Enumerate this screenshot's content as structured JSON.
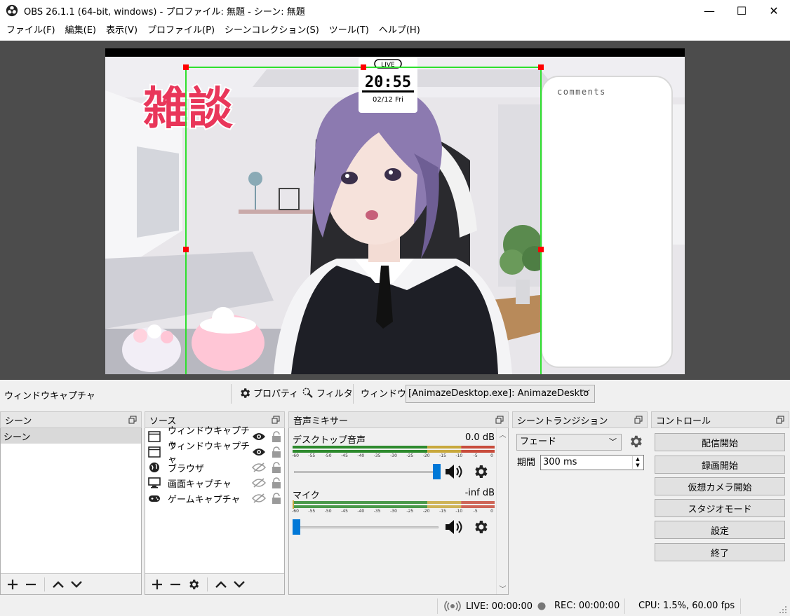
{
  "window": {
    "title": "OBS 26.1.1 (64-bit, windows) - プロファイル: 無題 - シーン: 無題",
    "minimize": "—",
    "maximize": "☐",
    "close": "✕"
  },
  "menu": [
    "ファイル(F)",
    "編集(E)",
    "表示(V)",
    "プロファイル(P)",
    "シーンコレクション(S)",
    "ツール(T)",
    "ヘルプ(H)"
  ],
  "preview": {
    "clock_badge": "LIVE",
    "clock_time": "20:55",
    "clock_date": "02/12 Fri",
    "title_sticker": "雑談",
    "comments_label": "comments"
  },
  "source_toolbar": {
    "selected_source": "ウィンドウキャプチャ",
    "properties": "プロパティ",
    "filters": "フィルタ",
    "window_label": "ウィンドウ",
    "window_value": "[AnimazeDesktop.exe]: AnimazeDeskto"
  },
  "scenes": {
    "title": "シーン",
    "items": [
      "シーン"
    ]
  },
  "sources": {
    "title": "ソース",
    "items": [
      {
        "label": "ウィンドウキャプチャ",
        "icon": "window-icon",
        "visible": true
      },
      {
        "label": "ウィンドウキャプチャ",
        "icon": "window-icon",
        "visible": true
      },
      {
        "label": "ブラウザ",
        "icon": "globe-icon",
        "visible": false
      },
      {
        "label": "画面キャプチャ",
        "icon": "monitor-icon",
        "visible": false
      },
      {
        "label": "ゲームキャプチャ",
        "icon": "gamepad-icon",
        "visible": false
      }
    ]
  },
  "mixer": {
    "title": "音声ミキサー",
    "ticks": [
      "-60",
      "-55",
      "-50",
      "-45",
      "-40",
      "-35",
      "-30",
      "-25",
      "-20",
      "-15",
      "-10",
      "-5",
      "0"
    ],
    "channels": [
      {
        "name": "デスクトップ音声",
        "db": "0.0 dB",
        "level": 1.0
      },
      {
        "name": "マイク",
        "db": "-inf dB",
        "level": 0.0
      }
    ]
  },
  "transitions": {
    "title": "シーントランジション",
    "selected": "フェード",
    "duration_label": "期間",
    "duration_value": "300 ms"
  },
  "controls": {
    "title": "コントロール",
    "buttons": [
      "配信開始",
      "録画開始",
      "仮想カメラ開始",
      "スタジオモード",
      "設定",
      "終了"
    ]
  },
  "status": {
    "live": "LIVE: 00:00:00",
    "rec": "REC: 00:00:00",
    "cpu": "CPU: 1.5%, 60.00 fps"
  },
  "colors": {
    "accent": "#0078d7",
    "meter_green": "#2d8a2d",
    "meter_yellow": "#c8a83c",
    "meter_red": "#c84c3c",
    "bounding_box": "#2ee02e",
    "handle": "#ff0000"
  }
}
